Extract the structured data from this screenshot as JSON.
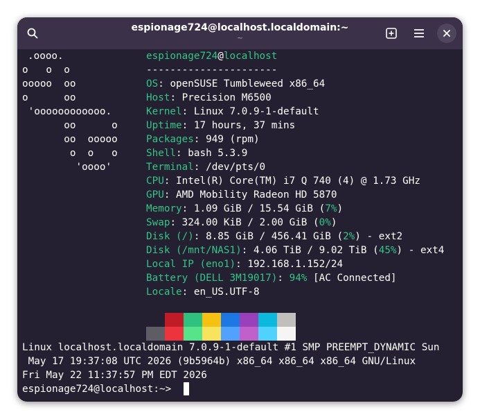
{
  "window": {
    "title": "espionage724@localhost.localdomain:~",
    "subtitle": "~"
  },
  "buttons": {
    "search_icon": "search-icon",
    "new_tab_icon": "new-tab-icon",
    "menu_icon": "hamburger-menu-icon",
    "close_icon": "close-icon"
  },
  "logo": [
    ".oooo.",
    "o   o  o",
    "ooooo  oo",
    "o      oo",
    " 'oooooooooooo.",
    "       oo      o",
    "       oo  ooooo",
    "        o  o   o",
    "         'oooo'"
  ],
  "fetch": {
    "user": "espionage724",
    "at": "@",
    "host": "localhost",
    "separator": "----------------------",
    "rows": [
      {
        "key": "OS",
        "sep": ": ",
        "value": "openSUSE Tumbleweed x86_64"
      },
      {
        "key": "Host",
        "sep": ": ",
        "value": "Precision M6500"
      },
      {
        "key": "Kernel",
        "sep": ": ",
        "value": "Linux 7.0.9-1-default"
      },
      {
        "key": "Uptime",
        "sep": ": ",
        "value": "17 hours, 37 mins"
      },
      {
        "key": "Packages",
        "sep": ": ",
        "value": "949 (rpm)"
      },
      {
        "key": "Shell",
        "sep": ": ",
        "value": "bash 5.3.9"
      },
      {
        "key": "Terminal",
        "sep": ": ",
        "value": "/dev/pts/0"
      },
      {
        "key": "CPU",
        "sep": ": ",
        "value": "Intel(R) Core(TM) i7 Q 740 (4) @ 1.73 GHz"
      },
      {
        "key": "GPU",
        "sep": ": ",
        "value": "AMD Mobility Radeon HD 5870"
      }
    ],
    "memory": {
      "key": "Memory",
      "value": "1.09 GiB / 15.54 GiB (",
      "pct": "7%",
      "end": ")"
    },
    "swap": {
      "key": "Swap",
      "value": "324.00 KiB / 2.00 GiB (",
      "pct": "0%",
      "end": ")"
    },
    "disk_root": {
      "key": "Disk (/)",
      "value": "8.85 GiB / 456.41 GiB (",
      "pct": "2%",
      "end": ") - ext2"
    },
    "disk_nas": {
      "key": "Disk (/mnt/NAS1)",
      "value": "4.06 TiB / 9.02 TiB (",
      "pct": "45%",
      "end": ") - ext4"
    },
    "local_ip": {
      "key": "Local IP (eno1)",
      "value": "192.168.1.152/24"
    },
    "battery": {
      "key": "Battery (DELL 3M19017)",
      "pct": "94%",
      "value": " [AC Connected]"
    },
    "locale": {
      "key": "Locale",
      "value": "en_US.UTF-8"
    }
  },
  "palette": {
    "normal": [
      "#241f31",
      "#c01c28",
      "#2ec27e",
      "#f5c211",
      "#1e78e4",
      "#9841bb",
      "#0ab9dc",
      "#c0bfbc"
    ],
    "bright": [
      "#5e5c64",
      "#ed333b",
      "#57e389",
      "#f8e45c",
      "#51a1ff",
      "#c061cb",
      "#4fd2fd",
      "#f6f5f4"
    ]
  },
  "output": {
    "uname_1": "Linux localhost.localdomain 7.0.9-1-default #1 SMP PREEMPT_DYNAMIC Sun",
    "uname_2": " May 17 19:37:08 UTC 2026 (9b5964b) x86_64 x86_64 x86_64 GNU/Linux",
    "date": "Fri May 22 11:37:57 PM EDT 2026",
    "prompt": "espionage724@localhost:~> "
  }
}
